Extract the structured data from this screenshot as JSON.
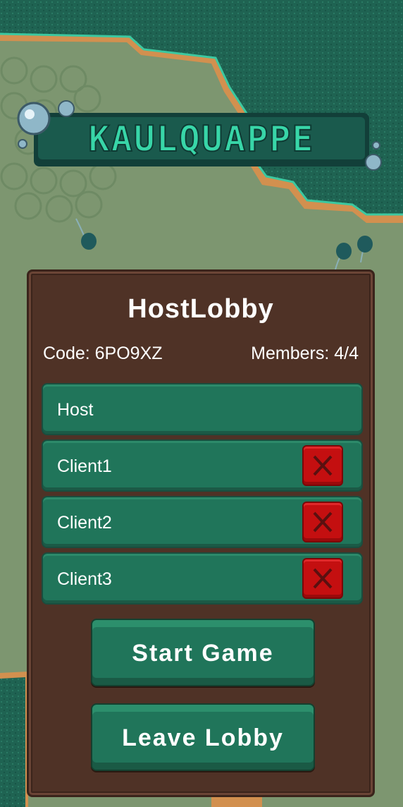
{
  "logo": {
    "text": "KAULQUAPPE"
  },
  "lobby": {
    "title": "HostLobby",
    "code_label": "Code: 6PO9XZ",
    "members_label": "Members: 4/4",
    "members": [
      {
        "name": "Host",
        "kickable": false
      },
      {
        "name": "Client1",
        "kickable": true
      },
      {
        "name": "Client2",
        "kickable": true
      },
      {
        "name": "Client3",
        "kickable": true
      }
    ],
    "kick_icon": "x-icon",
    "start_label": "Start Game",
    "leave_label": "Leave Lobby"
  },
  "colors": {
    "panel": "#4f3226",
    "row": "#20755a",
    "kick": "#c40f10",
    "water": "#1f6352",
    "ground": "#7d9670"
  }
}
